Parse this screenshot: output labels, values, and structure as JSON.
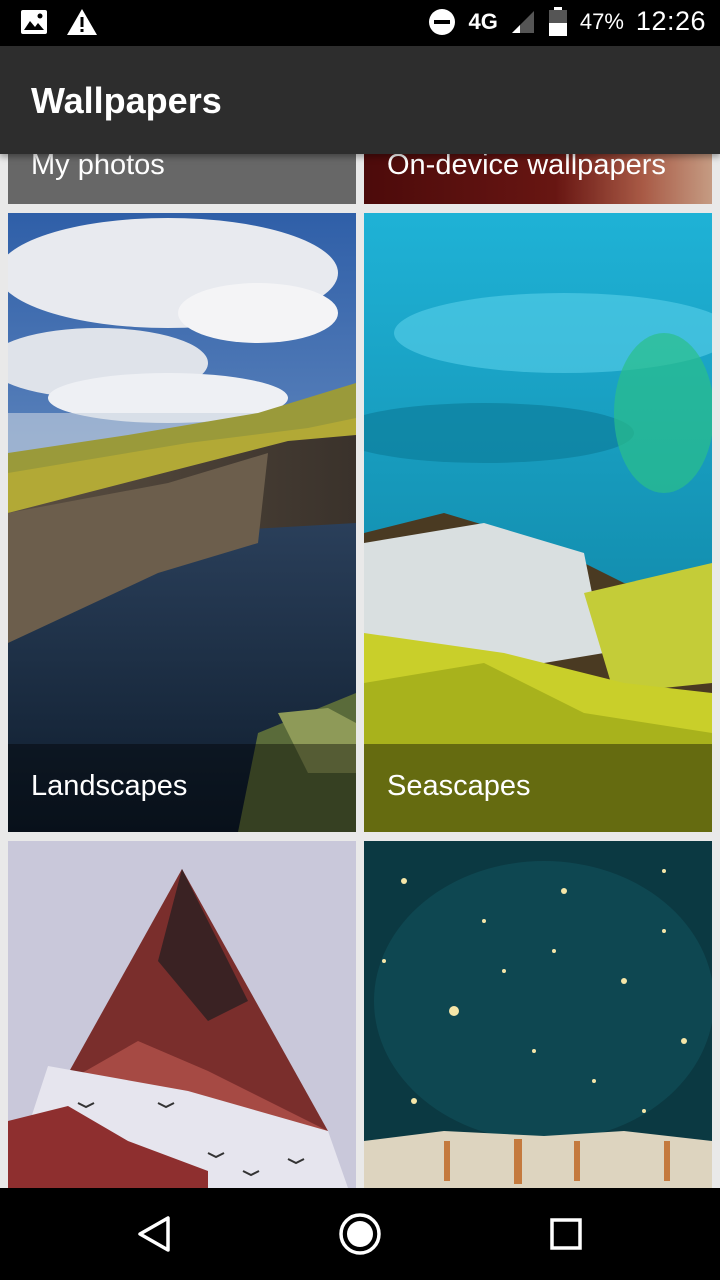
{
  "status_bar": {
    "network": "4G",
    "battery_percent": "47%",
    "time": "12:26",
    "icons": [
      "image-icon",
      "warning-icon",
      "do-not-disturb-icon",
      "signal-icon",
      "battery-icon"
    ]
  },
  "app_bar": {
    "title": "Wallpapers"
  },
  "categories": [
    {
      "label": "My photos"
    },
    {
      "label": "On-device wallpapers"
    },
    {
      "label": "Landscapes"
    },
    {
      "label": "Seascapes"
    }
  ],
  "nav_bar": {
    "icons": [
      "back-icon",
      "home-icon",
      "recents-icon"
    ]
  },
  "colors": {
    "app_bar": "#2d2d2d",
    "status_bar": "#000000",
    "background": "#e9e9e9"
  }
}
